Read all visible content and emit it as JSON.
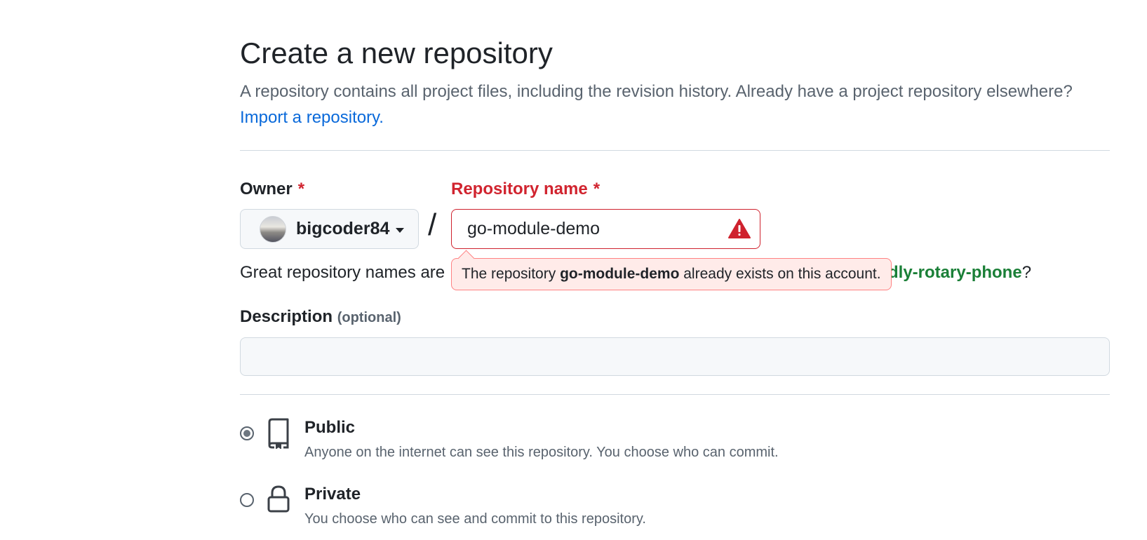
{
  "page": {
    "title": "Create a new repository",
    "subtitle": "A repository contains all project files, including the revision history. Already have a project repository elsewhere?",
    "import_link": "Import a repository."
  },
  "owner": {
    "label": "Owner",
    "required_mark": "*",
    "name": "bigcoder84",
    "avatar_icon": "avatar-icon",
    "caret_icon": "chevron-down-icon"
  },
  "separator": "/",
  "repo_name": {
    "label": "Repository name",
    "required_mark": "*",
    "value": "go-module-demo",
    "error_icon": "alert-icon"
  },
  "error_tooltip": {
    "prefix": "The repository",
    "repo": "go-module-demo",
    "suffix": "already exists on this account."
  },
  "hint": {
    "prefix": "Great repository names are",
    "suggestion_tail": "dly-rotary-phone",
    "suffix": "?"
  },
  "description": {
    "label": "Description",
    "optional": "(optional)",
    "value": ""
  },
  "visibility": {
    "options": [
      {
        "title": "Public",
        "desc": "Anyone on the internet can see this repository. You choose who can commit.",
        "icon": "repo-icon",
        "checked": true
      },
      {
        "title": "Private",
        "desc": "You choose who can see and commit to this repository.",
        "icon": "lock-icon",
        "checked": false
      }
    ]
  },
  "colors": {
    "error": "#d1242f",
    "link": "#0969da",
    "suggestion": "#1a7f37",
    "tooltip_bg": "#ffebe9"
  }
}
